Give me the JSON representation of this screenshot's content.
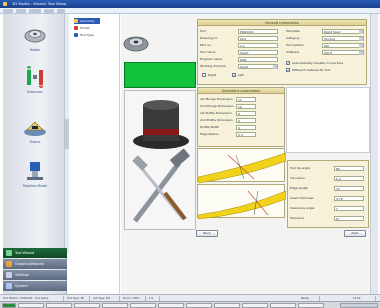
{
  "window": {
    "title": "3D Studio - Wizard: Tool Setup"
  },
  "sidebar": {
    "items": [
      {
        "label": "Holder"
      },
      {
        "label": "Extension"
      },
      {
        "label": "Fixture"
      },
      {
        "label": "Machine Model"
      }
    ],
    "bars": [
      {
        "label": "Tool Wizard",
        "color": "#1c6a3a"
      },
      {
        "label": "Graphics/Reports",
        "color": "#6d7b90"
      },
      {
        "label": "Settings",
        "color": "#6d7b90"
      },
      {
        "label": "System",
        "color": "#6d7b90"
      }
    ]
  },
  "tree": {
    "items": [
      {
        "label": "Geometry"
      },
      {
        "label": "Holder"
      },
      {
        "label": "Tool Type"
      }
    ]
  },
  "general": {
    "title": "General information",
    "left_rows": [
      {
        "label": "Tool",
        "value": "PGN1201"
      },
      {
        "label": "Drawing no.",
        "value": "W/A"
      },
      {
        "label": "Part no.",
        "value": "1.1"
      },
      {
        "label": "Tool name",
        "value": "Insert"
      },
      {
        "label": "Program name",
        "value": "PGN"
      },
      {
        "label": "Working direction",
        "value": "Right"
      }
    ],
    "right_rows": [
      {
        "label": "Template",
        "value": "Right hand"
      },
      {
        "label": "Category",
        "value": "Turning"
      },
      {
        "label": "Tool system",
        "value": "ISO"
      },
      {
        "label": "Software",
        "value": "ISO-P"
      }
    ],
    "checkboxes": [
      {
        "label": "Automatically transfer to machine",
        "checked": true
      },
      {
        "label": "Different material for tool",
        "checked": true
      },
      {
        "label": "Right",
        "checked": false
      },
      {
        "label": "Left",
        "checked": true
      }
    ]
  },
  "dimensions": {
    "title": "Geometric parameters",
    "rows": [
      {
        "label": "1st Plunge Dimension",
        "value": "12"
      },
      {
        "label": "2nd Plunge Dimension",
        "value": "10"
      },
      {
        "label": "1st Profile Dimension",
        "value": "8"
      },
      {
        "label": "2nd Profile Dimension",
        "value": "6"
      },
      {
        "label": "Profile Width",
        "value": "4"
      },
      {
        "label": "Edge Radius",
        "value": "0.4"
      }
    ]
  },
  "right_panel": {
    "rows": [
      {
        "label": "Tool tip angle",
        "value": "80"
      },
      {
        "label": "Tip radius",
        "value": "0.4"
      },
      {
        "label": "Edge length",
        "value": "12"
      },
      {
        "label": "Insert thickness",
        "value": "4.76"
      },
      {
        "label": "Clearance angle",
        "value": "7"
      },
      {
        "label": "Tolerance",
        "value": "M"
      }
    ]
  },
  "buttons": {
    "prev": "Back",
    "next": "Next"
  },
  "statusbar": {
    "segments": [
      "Tool Wizard - PGN1201 - Tool Setup",
      "Tool Type: 3D",
      "Cut Type: Ext",
      "Zoom: 100%",
      "1/1",
      "Ready",
      "14:02"
    ]
  },
  "colors": {
    "accent": "#2b5bb0",
    "green_block": "#11c23c",
    "panel_bg": "#f6f1d8"
  }
}
